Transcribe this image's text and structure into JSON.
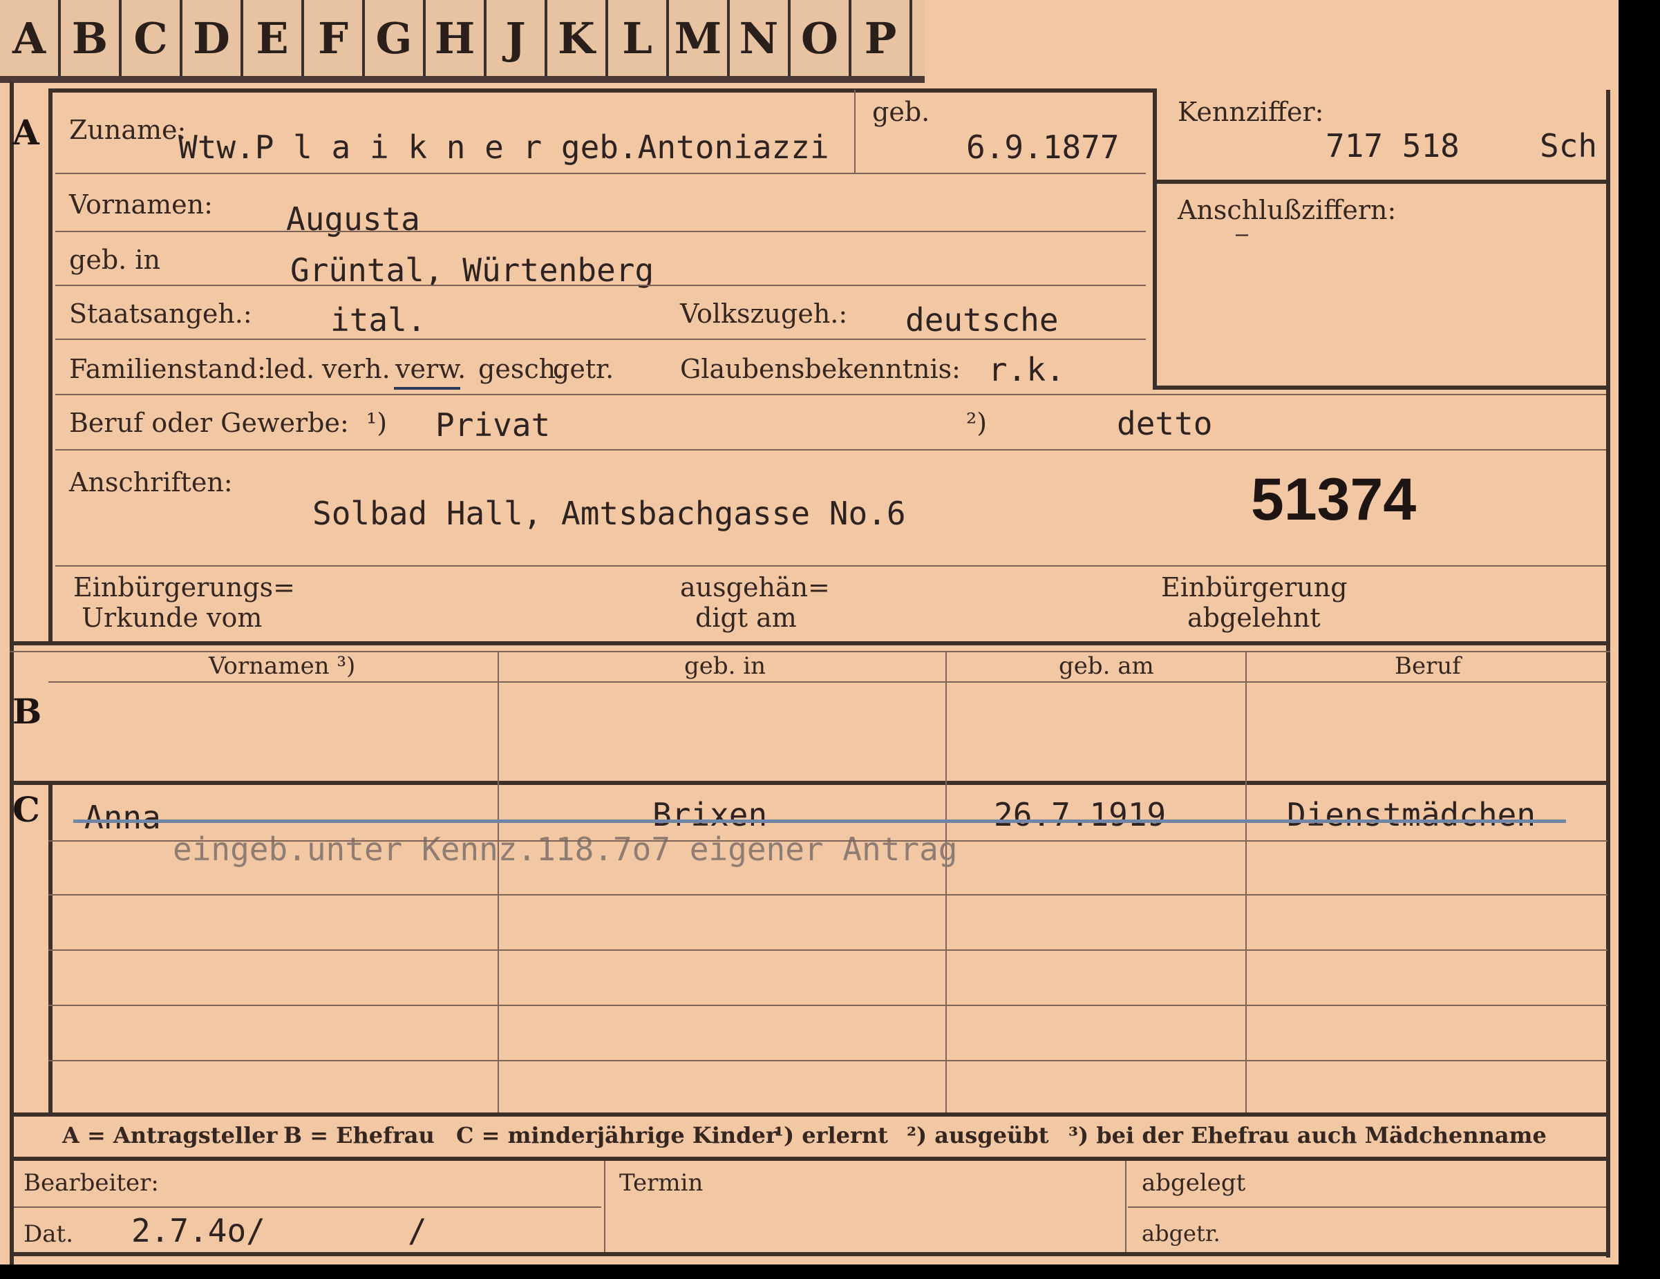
{
  "tabs": [
    "A",
    "B",
    "C",
    "D",
    "E",
    "F",
    "G",
    "H",
    "J",
    "K",
    "L",
    "M",
    "N",
    "O",
    "P"
  ],
  "sections": {
    "a": "A",
    "b": "B",
    "c": "C"
  },
  "a": {
    "zuname_label": "Zuname:",
    "zuname_value": "Wtw.P l a i k n e r  geb.Antoniazzi",
    "geb_label": "geb.",
    "geb_date": "6.9.1877",
    "vornamen_label": "Vornamen:",
    "vornamen_value": "Augusta",
    "gebin_label": "geb. in",
    "gebin_value": "Grüntal, Würtenberg",
    "staats_label": "Staatsangeh.:",
    "staats_value": "ital.",
    "volks_label": "Volkszugeh.:",
    "volks_value": "deutsche",
    "famstand_label": "Familienstand:",
    "famstand_options": [
      "led.",
      "verh.",
      "verw.",
      "gesch.",
      "getr."
    ],
    "glauben_label": "Glaubensbekenntnis:",
    "glauben_value": "r.k.",
    "beruf_label": "Beruf oder Gewerbe:",
    "beruf_1_marker": "¹)",
    "beruf_1_value": "Privat",
    "beruf_2_marker": "²)",
    "beruf_2_value": "detto",
    "anschriften_label": "Anschriften:",
    "anschriften_value": "Solbad Hall, Amtsbachgasse No.6",
    "stamp_number": "51374",
    "einb_urk_label_1": "Einbürgerungs=",
    "einb_urk_label_2": "Urkunde vom",
    "ausgeh_label_1": "ausgehän=",
    "ausgeh_label_2": "digt am",
    "abgelehnt_label_1": "Einbürgerung",
    "abgelehnt_label_2": "abgelehnt"
  },
  "kennziffer": {
    "label": "Kennziffer:",
    "value": "717 518",
    "suffix": "Sch",
    "anschluss_label": "Anschlußziffern:",
    "anschluss_value": "–"
  },
  "table": {
    "headers": [
      "Vornamen ³)",
      "geb. in",
      "geb. am",
      "Beruf"
    ],
    "children": [
      {
        "vorname": "Anna",
        "gebin": "Brixen",
        "gebam": "26.7.1919",
        "beruf": "Dienstmädchen"
      }
    ],
    "note": "eingeb.unter Kennz.118.7o7 eigener Antrag"
  },
  "legend": {
    "a": "A = Antragsteller",
    "b": "B = Ehefrau",
    "c": "C = minderjährige Kinder",
    "n1": "¹) erlernt",
    "n2": "²) ausgeübt",
    "n3": "³) bei der Ehefrau auch Mädchenname"
  },
  "footer": {
    "bearbeiter_label": "Bearbeiter:",
    "termin_label": "Termin",
    "abgelegt_label": "abgelegt",
    "dat_label": "Dat.",
    "dat_value": "2.7.4o/",
    "dat_slash": "/",
    "abgetr_label": "abgetr."
  }
}
